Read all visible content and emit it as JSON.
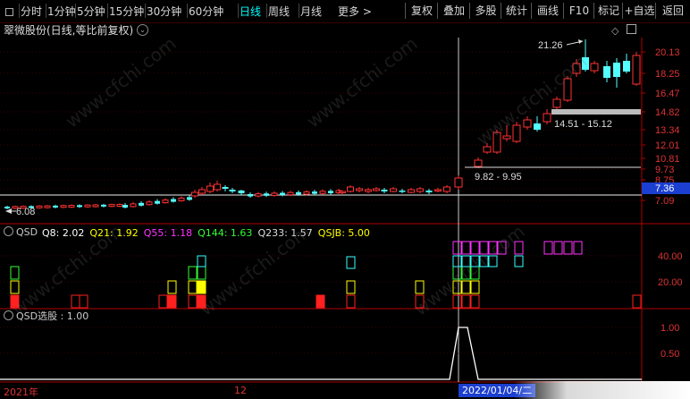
{
  "toolbar": {
    "periods": [
      "分时",
      "1分钟",
      "5分钟",
      "15分钟",
      "30分钟",
      "60分钟",
      "日线",
      "周线",
      "月线"
    ],
    "active_period": "日线",
    "more": "更多 >",
    "right_buttons": [
      "复权",
      "叠加",
      "多股",
      "统计",
      "画线",
      "F10",
      "标记",
      "+自选",
      "返回"
    ]
  },
  "chart": {
    "title": "翠微股份(日线,等比前复权)",
    "price_labels": [
      "20.13",
      "18.25",
      "16.47",
      "14.82",
      "13.34",
      "12.01",
      "10.81",
      "9.73",
      "8.75",
      "7.36",
      "7.09"
    ],
    "current_price": "7.36",
    "high_annotation": "21.26",
    "low_annotation": "6.08",
    "range_labels": [
      "14.51 - 15.12",
      "9.82 - 9.95"
    ]
  },
  "indicator": {
    "name": "QSD",
    "values": [
      {
        "label": "Q8: 2.02",
        "color": "#ffffff"
      },
      {
        "label": "Q21: 1.92",
        "color": "#ffff00"
      },
      {
        "label": "Q55: 1.18",
        "color": "#ff33ff"
      },
      {
        "label": "Q144: 1.63",
        "color": "#33ff33"
      },
      {
        "label": "Q233: 1.57",
        "color": "#dddddd"
      },
      {
        "label": "QSJB: 5.00",
        "color": "#ffff00"
      }
    ],
    "axis": [
      "40.00",
      "20.00"
    ]
  },
  "selector": {
    "label": "QSD选股 : 1.00",
    "axis": [
      "1.00",
      "0.50"
    ]
  },
  "dates": {
    "left": "2021年",
    "mid": "12",
    "cursor": "2022/01/04/二"
  },
  "watermark": "www.cfchi.com",
  "colors": {
    "up": "#ff3232",
    "down": "#54ffff",
    "axis": "#b00000"
  }
}
